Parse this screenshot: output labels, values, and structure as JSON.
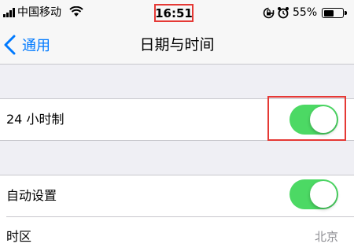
{
  "status_bar": {
    "carrier": "中国移动",
    "time": "16:51",
    "battery_percent": "55%",
    "battery_level": 0.55,
    "icons": [
      "signal-icon",
      "wifi-icon",
      "rotation-lock-icon",
      "alarm-icon",
      "battery-icon"
    ]
  },
  "nav": {
    "back_label": "通用",
    "title": "日期与时间"
  },
  "settings": {
    "hour24": {
      "label": "24 小时制",
      "on": true
    },
    "auto_set": {
      "label": "自动设置",
      "on": true
    },
    "timezone": {
      "label": "时区",
      "value": "北京"
    }
  },
  "colors": {
    "accent_blue": "#007aff",
    "switch_on": "#4cd964",
    "highlight": "#e53935"
  }
}
